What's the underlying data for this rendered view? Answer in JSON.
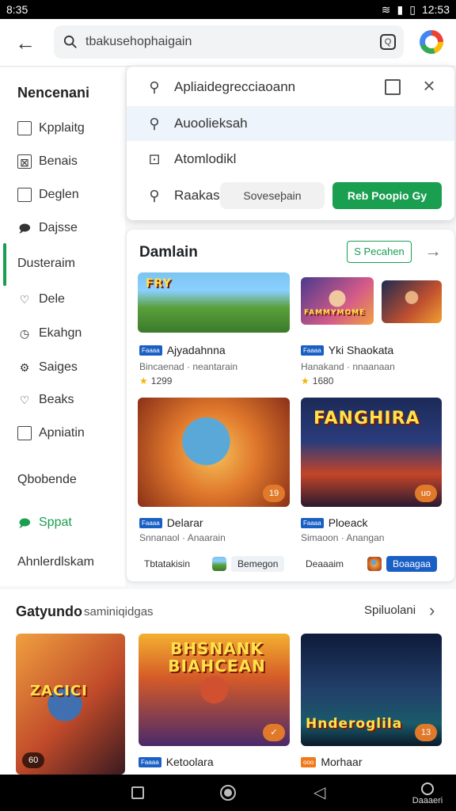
{
  "status": {
    "time_left": "8:35",
    "time_right": "12:53"
  },
  "search": {
    "query": "tbakusehophaigain",
    "qr_label": "Q"
  },
  "sidebar": {
    "title": "Nencenani",
    "items": [
      {
        "label": "Kpplaitg",
        "icon": "checkbox-icon"
      },
      {
        "label": "Benais",
        "icon": "image-icon"
      },
      {
        "label": "Deglen",
        "icon": "checkbox-icon"
      },
      {
        "label": "Dajsse",
        "icon": "chat-icon"
      },
      {
        "label": "Dusteraim",
        "icon": ""
      },
      {
        "label": "Dele",
        "icon": "heart-icon"
      },
      {
        "label": "Ekahgn",
        "icon": "clock-icon"
      },
      {
        "label": "Saiges",
        "icon": "gear-icon"
      },
      {
        "label": "Beaks",
        "icon": "heart-icon"
      },
      {
        "label": "Apniatin",
        "icon": "checkbox-icon"
      },
      {
        "label": "Qbobende",
        "icon": ""
      },
      {
        "label": "Sppat",
        "icon": "chat-icon"
      },
      {
        "label": "Ahnlerdlskam",
        "icon": ""
      }
    ]
  },
  "dropdown": {
    "rows": [
      {
        "label": "Apliaidegrecciaoann",
        "icon": "search-icon"
      },
      {
        "label": "Auoolieksah",
        "icon": "search-icon"
      },
      {
        "label": "Atomlodikl",
        "icon": "page-search-icon"
      },
      {
        "label": "Raakas",
        "icon": "search-icon"
      }
    ],
    "chip_secondary": "Soveseþain",
    "chip_primary": "Reb Poopio Gy"
  },
  "panel": {
    "title": "Damlain",
    "action": "S Pecahen",
    "games": [
      {
        "title": "Ajyadahnna",
        "sub": "Bincaenad · neantarain",
        "rating": "1299",
        "publisher": "Faaaa"
      },
      {
        "title": "Yki Shaokata",
        "sub": "Hanakand · nnaanaan",
        "rating": "1680",
        "publisher": "Faaaa"
      },
      {
        "title": "Delarar",
        "sub": "Snnanaol · Anaarain",
        "publisher": "Faaaa",
        "badge": "19"
      },
      {
        "title": "Ploeack",
        "sub": "Simaoon · Anangan",
        "publisher": "Faaaa",
        "badge": "uo"
      }
    ],
    "thumb_labels": [
      "FRY",
      "FAMMYMOME",
      "FANGHIRA"
    ],
    "bottom_row": {
      "left_label": "Tbtatakisin",
      "left_tag": "Bemegon",
      "right_label": "Deaaaim",
      "right_tag": "Boaagaa"
    }
  },
  "section": {
    "title": "Gatyundo",
    "subtitle": "saminiqidgas",
    "link": "Spiluolani",
    "cards": [
      {
        "label": "ZACICI",
        "badge": "60"
      },
      {
        "label": "BHSNANK BIAHCEAN",
        "title": "Ketoolara",
        "publisher": "Faaaa",
        "badge": "✓"
      },
      {
        "label": "Hnderoglila",
        "title": "Morhaar",
        "publisher": "ooo",
        "badge": "13"
      }
    ]
  },
  "navbar": {
    "user_label": "Daaaeri"
  }
}
